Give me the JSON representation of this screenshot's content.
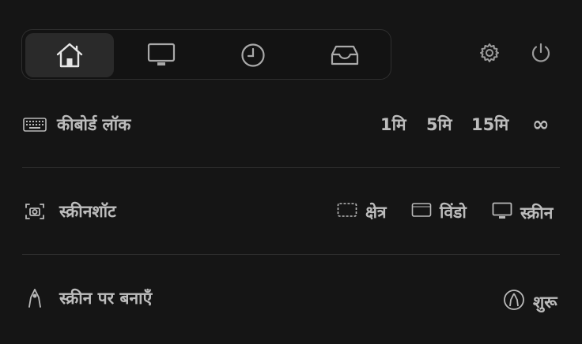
{
  "tabs": [
    {
      "name": "home-icon",
      "active": true
    },
    {
      "name": "monitor-icon",
      "active": false
    },
    {
      "name": "clock-icon",
      "active": false
    },
    {
      "name": "inbox-icon",
      "active": false
    }
  ],
  "top_actions": {
    "settings_icon": "gear-icon",
    "power_icon": "power-icon"
  },
  "keyboard_lock": {
    "label": "कीबोर्ड लॉक",
    "icon": "keyboard-icon",
    "options": [
      "1मि",
      "5मि",
      "15मि",
      "∞"
    ]
  },
  "screenshot": {
    "label": "स्क्रीनशॉट",
    "icon": "camera-icon",
    "options": [
      {
        "label": "क्षेत्र",
        "icon": "region-icon"
      },
      {
        "label": "विंडो",
        "icon": "window-icon"
      },
      {
        "label": "स्क्रीन",
        "icon": "monitor-icon"
      }
    ]
  },
  "draw_on_screen": {
    "label": "स्क्रीन पर बनाएँ",
    "icon": "pen-nib-icon",
    "action": {
      "label": "शुरू",
      "icon": "draw-start-icon"
    }
  },
  "colors": {
    "background": "#151515",
    "text": "#bcbcbc",
    "active_tab": "#2a2a2a",
    "divider": "#2e2e2e"
  }
}
